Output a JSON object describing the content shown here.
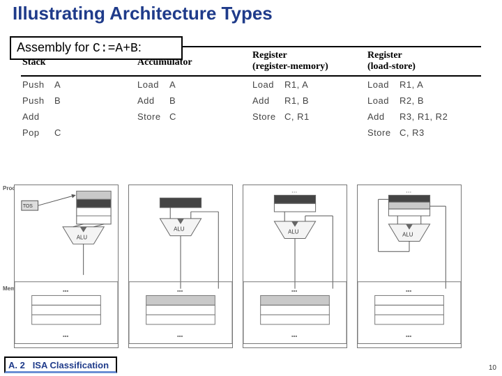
{
  "title": "Illustrating Architecture Types",
  "assembly_prefix": "Assembly for ",
  "assembly_code": "C:=A+B",
  "assembly_suffix": ":",
  "columns": [
    {
      "name": "Stack",
      "sub": ""
    },
    {
      "name": "Accumulator",
      "sub": ""
    },
    {
      "name": "Register",
      "sub": "(register-memory)"
    },
    {
      "name": "Register",
      "sub": "(load-store)"
    }
  ],
  "code": {
    "stack": [
      {
        "op": "Push",
        "args": "A"
      },
      {
        "op": "Push",
        "args": "B"
      },
      {
        "op": "Add",
        "args": ""
      },
      {
        "op": "Pop",
        "args": "C"
      }
    ],
    "accumulator": [
      {
        "op": "Load",
        "args": "A"
      },
      {
        "op": "Add",
        "args": "B"
      },
      {
        "op": "Store",
        "args": "C"
      }
    ],
    "reg_mem": [
      {
        "op": "Load",
        "args": "R1, A"
      },
      {
        "op": "Add",
        "args": "R1, B"
      },
      {
        "op": "Store",
        "args": "C, R1"
      }
    ],
    "load_store": [
      {
        "op": "Load",
        "args": "R1, A"
      },
      {
        "op": "Load",
        "args": "R2, B"
      },
      {
        "op": "Add",
        "args": "R3, R1, R2"
      },
      {
        "op": "Store",
        "args": "C, R3"
      }
    ]
  },
  "diagram_labels": {
    "processor": "Processor",
    "memory": "Memory",
    "alu": "ALU",
    "tos": "TOS",
    "dots": "..."
  },
  "footer": {
    "section": "A. 2",
    "label": "ISA Classification"
  },
  "page_number": "10"
}
